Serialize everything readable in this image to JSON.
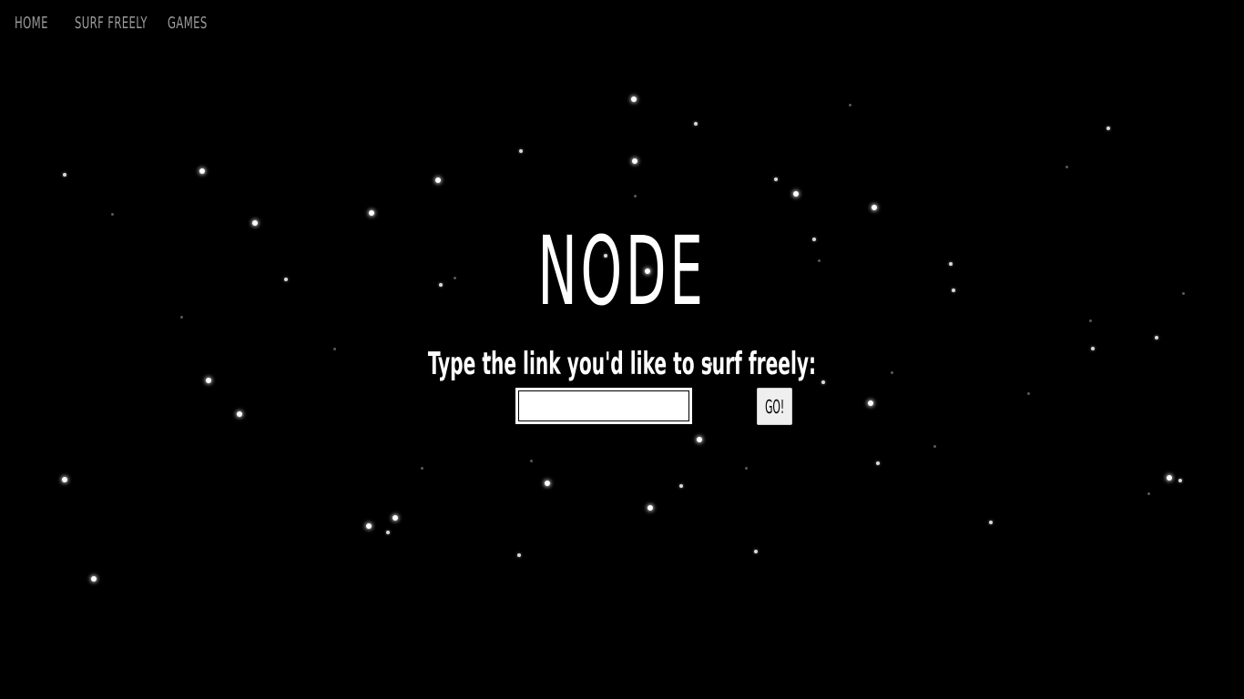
{
  "nav": {
    "items": [
      {
        "label": "HOME"
      },
      {
        "label": "SURF FREELY"
      },
      {
        "label": "GAMES"
      }
    ]
  },
  "hero": {
    "title": "NODE"
  },
  "form": {
    "prompt": "Type the link you'd like to surf freely:",
    "input_value": "",
    "input_placeholder": "",
    "go_label": "GO!"
  },
  "colors": {
    "background": "#000000",
    "text": "#ffffff",
    "nav_text": "#9a9a9a",
    "star": "#ffffff"
  }
}
